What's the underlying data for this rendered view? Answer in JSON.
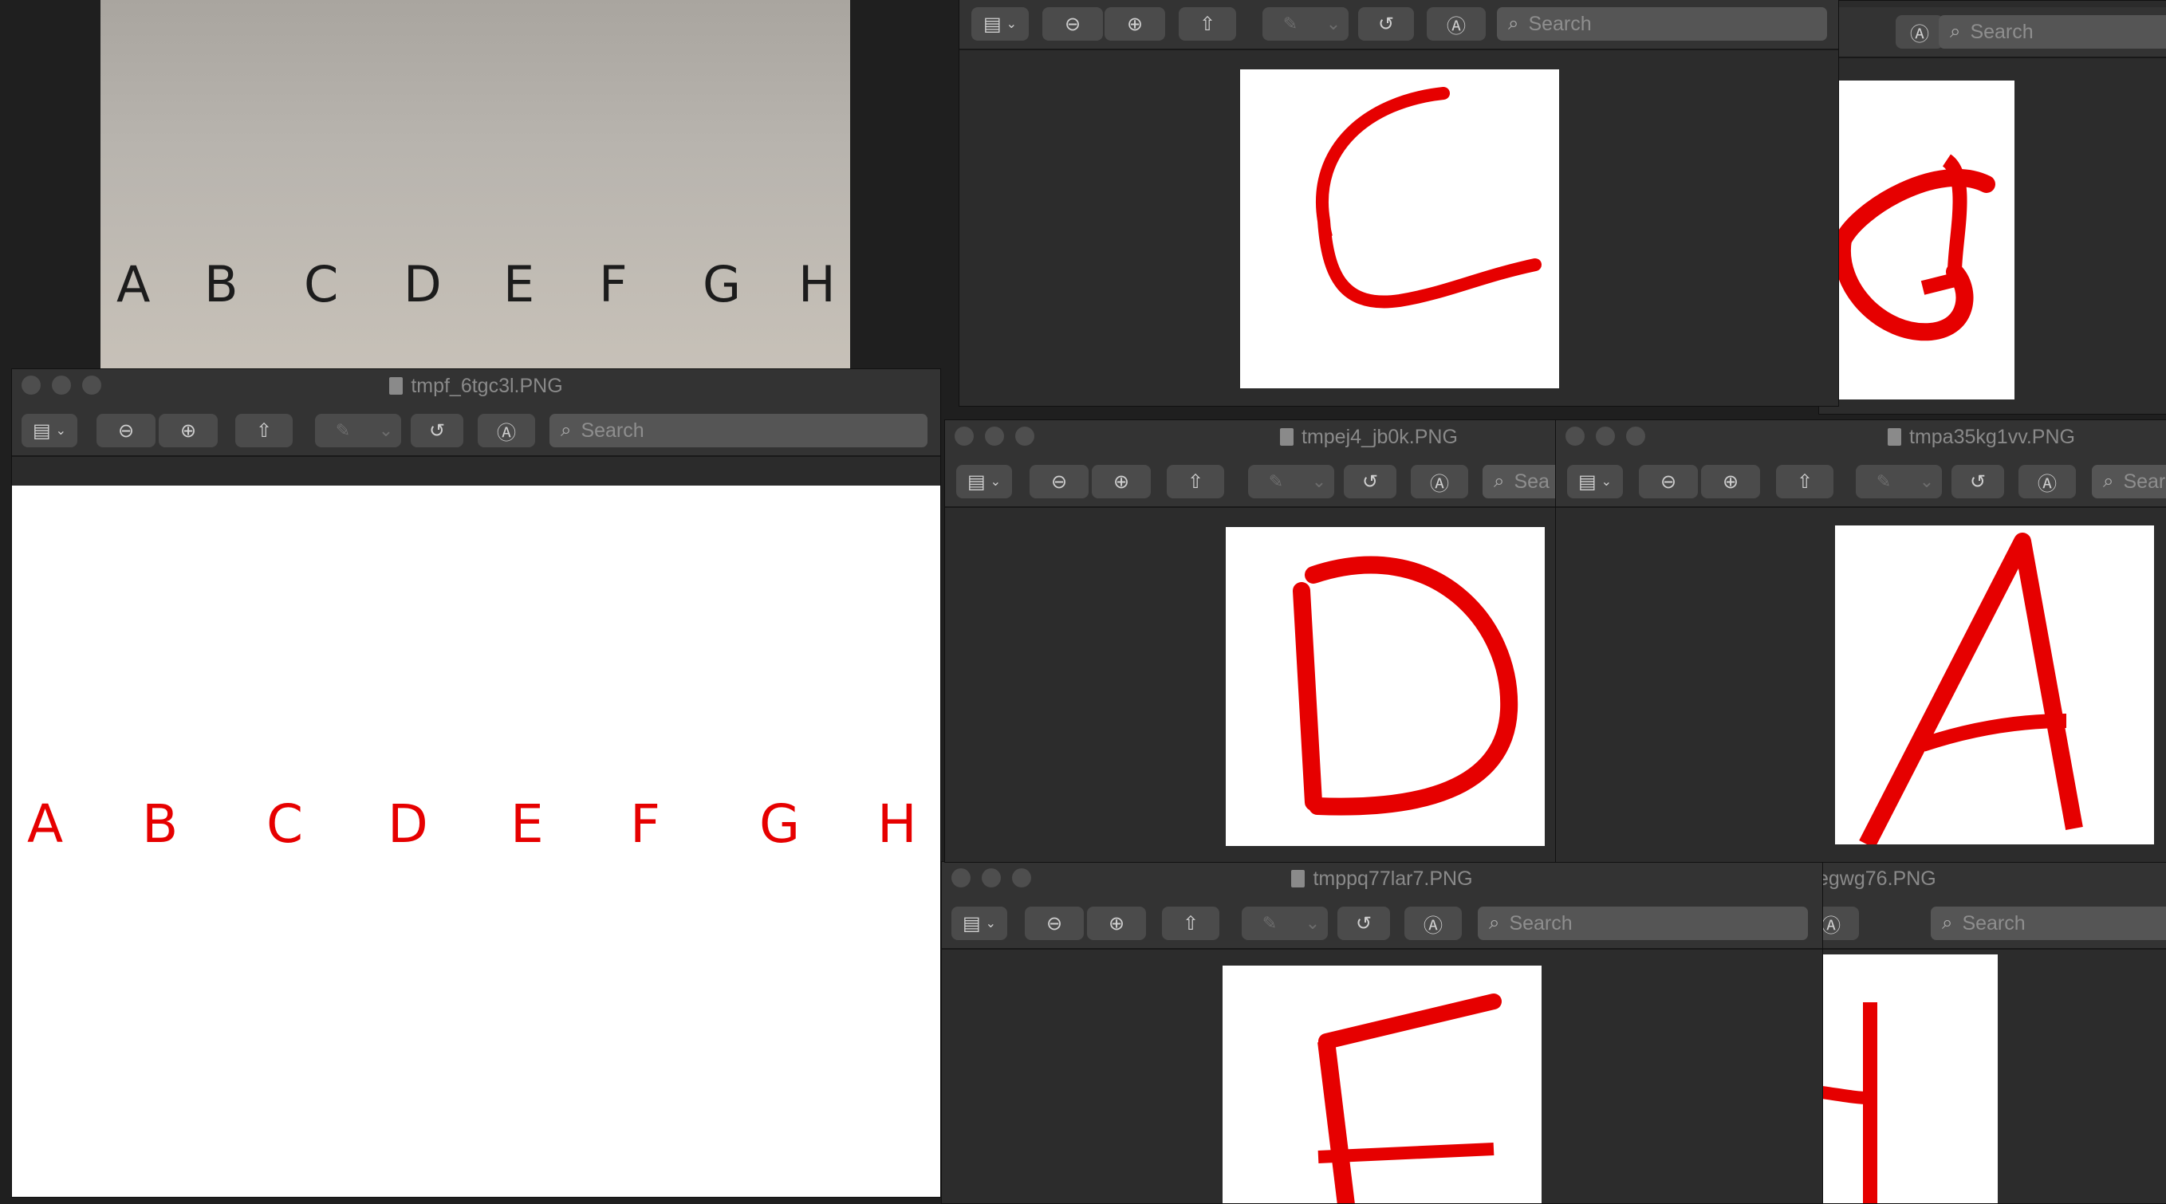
{
  "background_photo": {
    "letters": [
      "A",
      "B",
      "C",
      "D",
      "E",
      "F",
      "G",
      "H"
    ]
  },
  "windows": {
    "main": {
      "title": "tmpf_6tgc3l.PNG",
      "search_placeholder": "Search",
      "letters": [
        "A",
        "B",
        "C",
        "D",
        "E",
        "F",
        "G",
        "H"
      ]
    },
    "c_window": {
      "title": "",
      "search_placeholder": "Search",
      "letter": "C"
    },
    "g_window": {
      "title": "",
      "search_placeholder": "Search",
      "letter": "G"
    },
    "d_window": {
      "title": "tmpej4_jb0k.PNG",
      "search_placeholder": "Sea",
      "letter": "D"
    },
    "a_window": {
      "title": "tmpa35kg1vv.PNG",
      "search_placeholder": "Sear",
      "letter": "A"
    },
    "e_window": {
      "title": "tmppq77lar7.PNG",
      "search_placeholder": "Search",
      "letter": "E"
    },
    "h_window": {
      "title": "egwg76.PNG",
      "search_placeholder": "Search",
      "letter": "H"
    }
  },
  "icons": {
    "sidebar": "▤",
    "zoom_out": "⊖",
    "zoom_in": "⊕",
    "share": "⇧",
    "markup": "✎",
    "rotate": "↺",
    "annotate": "Ⓐ",
    "search": "⌕",
    "chevron": "⌄"
  },
  "colors": {
    "ink_red": "#e60000",
    "window_bg": "#2b2b2b",
    "toolbar_bg": "#333333"
  }
}
